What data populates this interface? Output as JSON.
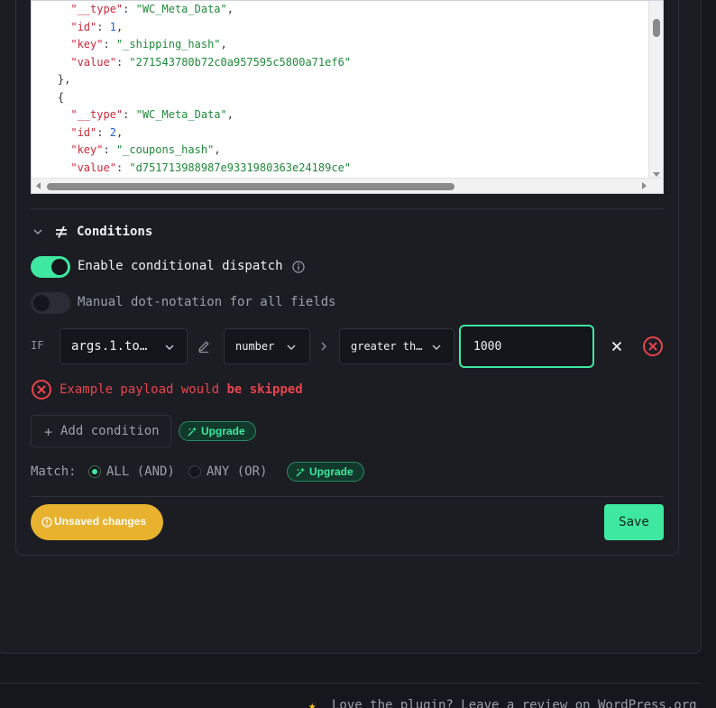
{
  "code_viewer": {
    "lines": [
      [
        {
          "t": "      ",
          "c": "p"
        },
        {
          "t": "\"__type\"",
          "c": "k"
        },
        {
          "t": ": ",
          "c": "p"
        },
        {
          "t": "\"WC_Meta_Data\"",
          "c": "s"
        },
        {
          "t": ",",
          "c": "p"
        }
      ],
      [
        {
          "t": "      ",
          "c": "p"
        },
        {
          "t": "\"id\"",
          "c": "k"
        },
        {
          "t": ": ",
          "c": "p"
        },
        {
          "t": "1",
          "c": "n"
        },
        {
          "t": ",",
          "c": "p"
        }
      ],
      [
        {
          "t": "      ",
          "c": "p"
        },
        {
          "t": "\"key\"",
          "c": "k"
        },
        {
          "t": ": ",
          "c": "p"
        },
        {
          "t": "\"_shipping_hash\"",
          "c": "s"
        },
        {
          "t": ",",
          "c": "p"
        }
      ],
      [
        {
          "t": "      ",
          "c": "p"
        },
        {
          "t": "\"value\"",
          "c": "k"
        },
        {
          "t": ": ",
          "c": "p"
        },
        {
          "t": "\"271543780b72c0a957595c5800a71ef6\"",
          "c": "s"
        }
      ],
      [
        {
          "t": "    },",
          "c": "p"
        }
      ],
      [
        {
          "t": "    {",
          "c": "p"
        }
      ],
      [
        {
          "t": "      ",
          "c": "p"
        },
        {
          "t": "\"__type\"",
          "c": "k"
        },
        {
          "t": ": ",
          "c": "p"
        },
        {
          "t": "\"WC_Meta_Data\"",
          "c": "s"
        },
        {
          "t": ",",
          "c": "p"
        }
      ],
      [
        {
          "t": "      ",
          "c": "p"
        },
        {
          "t": "\"id\"",
          "c": "k"
        },
        {
          "t": ": ",
          "c": "p"
        },
        {
          "t": "2",
          "c": "n"
        },
        {
          "t": ",",
          "c": "p"
        }
      ],
      [
        {
          "t": "      ",
          "c": "p"
        },
        {
          "t": "\"key\"",
          "c": "k"
        },
        {
          "t": ": ",
          "c": "p"
        },
        {
          "t": "\"_coupons_hash\"",
          "c": "s"
        },
        {
          "t": ",",
          "c": "p"
        }
      ],
      [
        {
          "t": "      ",
          "c": "p"
        },
        {
          "t": "\"value\"",
          "c": "k"
        },
        {
          "t": ": ",
          "c": "p"
        },
        {
          "t": "\"d751713988987e9331980363e24189ce\"",
          "c": "s"
        }
      ]
    ]
  },
  "conditions": {
    "title": "Conditions",
    "enable_label": "Enable conditional dispatch",
    "manual_label": "Manual dot-notation for all fields",
    "if_label": "IF",
    "field_value": "args.1.to…",
    "type_value": "number",
    "operator_value": "greater th…",
    "input_value": "1000",
    "error_prefix": "Example payload would ",
    "error_strong": "be skipped",
    "add_label": "Add condition",
    "upgrade_label": "Upgrade",
    "match_label": "Match:",
    "match_all": "ALL (AND)",
    "match_any": "ANY (OR)"
  },
  "footer_bar": {
    "unsaved_label": "Unsaved changes",
    "save_label": "Save"
  },
  "page_footer": {
    "text": "Love the plugin? Leave a review on WordPress.org"
  },
  "colors": {
    "accent": "#3ee8a0",
    "error": "#e8434c",
    "warning": "#e8b22e"
  }
}
